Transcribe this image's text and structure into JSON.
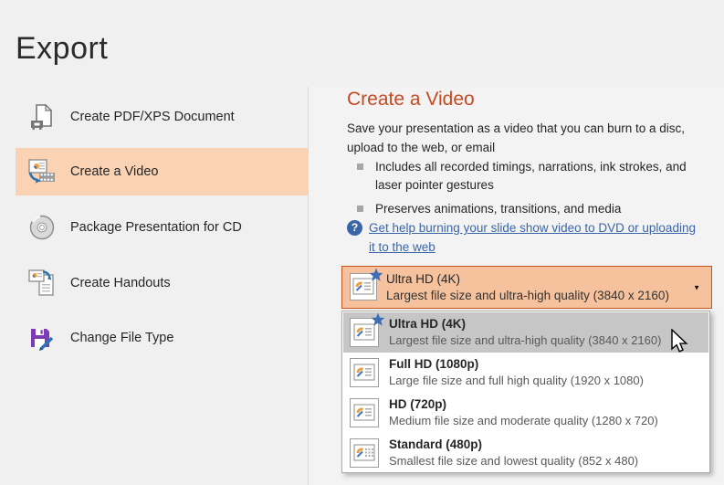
{
  "page": {
    "title": "Export"
  },
  "sidebar": {
    "items": [
      {
        "label": "Create PDF/XPS Document",
        "icon": "pdf-xps-document-icon",
        "selected": false
      },
      {
        "label": "Create a Video",
        "icon": "create-video-icon",
        "selected": true
      },
      {
        "label": "Package Presentation for CD",
        "icon": "package-cd-icon",
        "selected": false
      },
      {
        "label": "Create Handouts",
        "icon": "create-handouts-icon",
        "selected": false
      },
      {
        "label": "Change File Type",
        "icon": "change-file-type-icon",
        "selected": false
      }
    ]
  },
  "panel": {
    "heading": "Create a Video",
    "description": "Save your presentation as a video that you can burn to a disc, upload to the web, or email",
    "bullets": [
      "Includes all recorded timings, narrations, ink strokes, and laser pointer gestures",
      "Preserves animations, transitions, and media"
    ],
    "help_icon": "?",
    "help_link": "Get help burning your slide show video to DVD or uploading it to the web",
    "quality_dropdown": {
      "arrow_icon": "▼",
      "selected": {
        "title": "Ultra HD (4K)",
        "subtitle": "Largest file size and ultra-high quality (3840 x 2160)",
        "icon": "ultra-hd-icon"
      },
      "options": [
        {
          "title": "Ultra HD (4K)",
          "subtitle": "Largest file size and ultra-high quality (3840 x 2160)",
          "icon": "ultra-hd-icon",
          "highlighted": true
        },
        {
          "title": "Full HD (1080p)",
          "subtitle": "Large file size and full high quality (1920 x 1080)",
          "icon": "full-hd-icon",
          "highlighted": false
        },
        {
          "title": "HD (720p)",
          "subtitle": "Medium file size and moderate quality (1280 x 720)",
          "icon": "hd-720p-icon",
          "highlighted": false
        },
        {
          "title": "Standard (480p)",
          "subtitle": "Smallest file size and lowest quality (852 x 480)",
          "icon": "standard-480p-icon",
          "highlighted": false
        }
      ]
    }
  },
  "colors": {
    "background": "#f0f0f0",
    "heading_orange": "#c64a22",
    "combo_fill": "#f5c29d",
    "combo_border": "#c4561c",
    "sidebar_highlight": "#fad2b4",
    "option_highlight": "#c6c6c6",
    "link_blue": "#3a66a8",
    "text_dark": "#262626",
    "text_gray": "#595959"
  }
}
